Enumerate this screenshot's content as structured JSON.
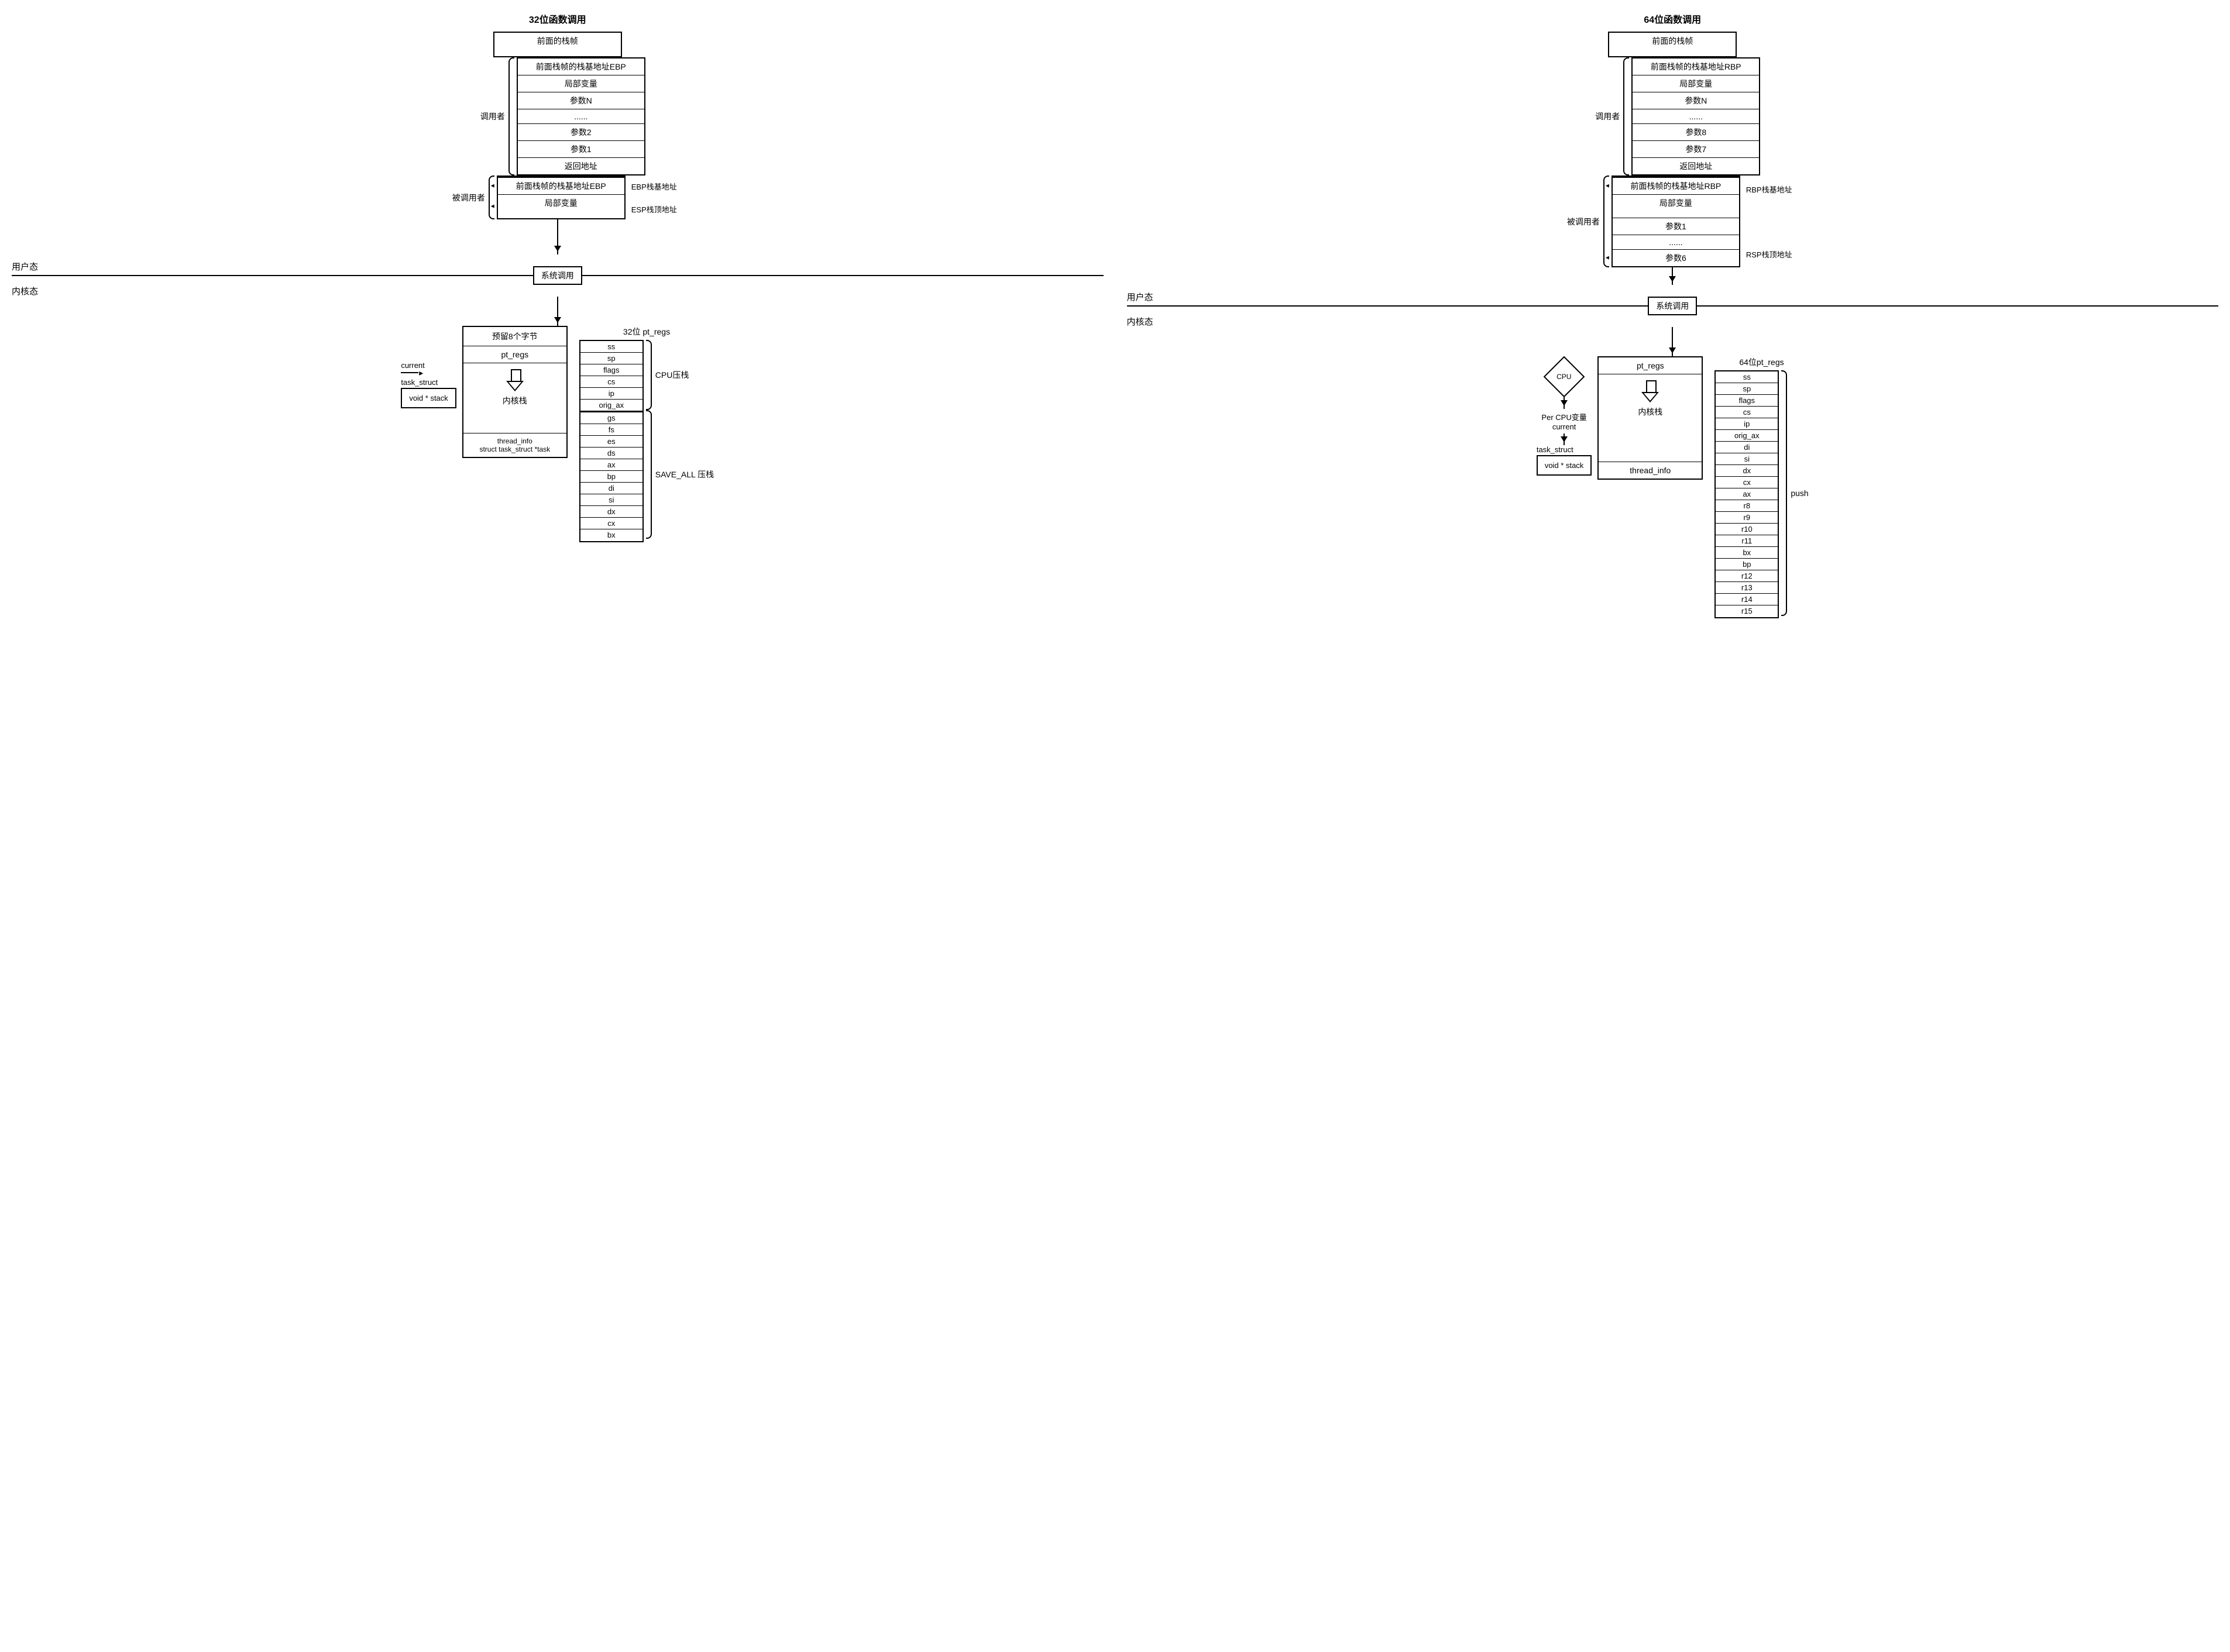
{
  "left": {
    "title": "32位函数调用",
    "prev_frame": "前面的栈帧",
    "caller_label": "调用者",
    "callee_label": "被调用者",
    "caller_cells": [
      "前面栈帧的栈基地址EBP",
      "局部变量",
      "参数N",
      "......",
      "参数2",
      "参数1",
      "返回地址"
    ],
    "callee_cells": [
      "前面栈帧的栈基地址EBP",
      "局部变量"
    ],
    "ebp_label": "EBP栈基地址",
    "esp_label": "ESP栈顶地址",
    "user_mode": "用户态",
    "kernel_mode": "内核态",
    "syscall": "系统调用",
    "current": "current",
    "task_struct": "task_struct",
    "void_stack": "void * stack",
    "reserve8": "预留8个字节",
    "pt_regs": "pt_regs",
    "kernel_stack": "内核栈",
    "thread_info": "thread_info\nstruct task_struct *task",
    "pt_title": "32位 pt_regs",
    "cpu_push": "CPU压栈",
    "save_all": "SAVE_ALL 压栈",
    "pt_cpu": [
      "ss",
      "sp",
      "flags",
      "cs",
      "ip",
      "orig_ax"
    ],
    "pt_save": [
      "gs",
      "fs",
      "es",
      "ds",
      "ax",
      "bp",
      "di",
      "si",
      "dx",
      "cx",
      "bx"
    ]
  },
  "right": {
    "title": "64位函数调用",
    "prev_frame": "前面的栈帧",
    "caller_label": "调用者",
    "callee_label": "被调用者",
    "caller_cells": [
      "前面栈帧的栈基地址RBP",
      "局部变量",
      "参数N",
      "......",
      "参数8",
      "参数7",
      "返回地址"
    ],
    "callee_cells": [
      "前面栈帧的栈基地址RBP",
      "局部变量",
      "参数1",
      "......",
      "参数6"
    ],
    "rbp_label": "RBP栈基地址",
    "rsp_label": "RSP栈顶地址",
    "user_mode": "用户态",
    "kernel_mode": "内核态",
    "syscall": "系统调用",
    "cpu": "CPU",
    "percpu": "Per CPU变量\ncurrent",
    "task_struct": "task_struct",
    "void_stack": "void * stack",
    "pt_regs": "pt_regs",
    "kernel_stack": "内核栈",
    "thread_info": "thread_info",
    "pt_title": "64位pt_regs",
    "push": "push",
    "pt_all": [
      "ss",
      "sp",
      "flags",
      "cs",
      "ip",
      "orig_ax",
      "di",
      "si",
      "dx",
      "cx",
      "ax",
      "r8",
      "r9",
      "r10",
      "r11",
      "bx",
      "bp",
      "r12",
      "r13",
      "r14",
      "r15"
    ]
  }
}
